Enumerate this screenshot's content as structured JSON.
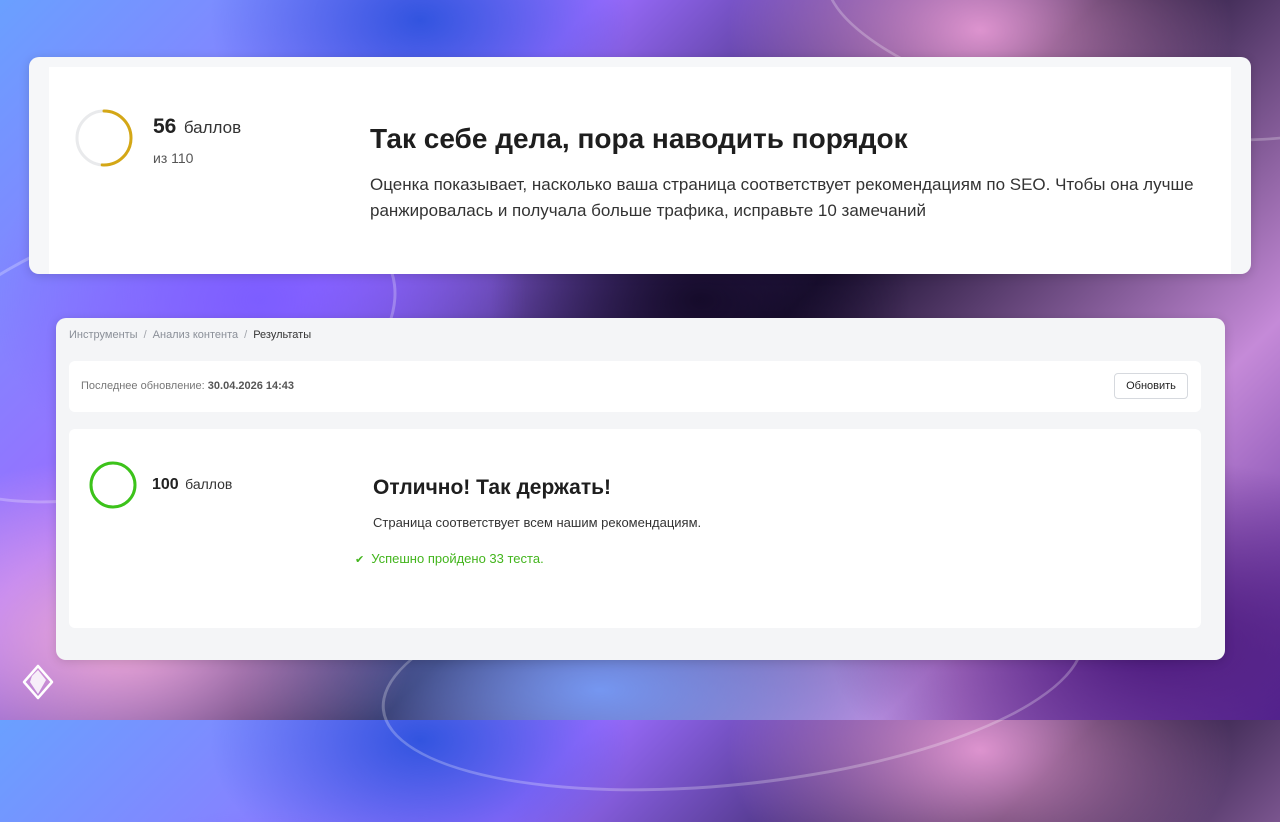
{
  "summary_card": {
    "score_value": "56",
    "score_unit": "баллов",
    "score_total": "из 110",
    "score_progress": 0.51,
    "ring_color": "#d4a716",
    "headline": "Так себе дела, пора наводить порядок",
    "description": "Оценка показывает, насколько ваша страница соответствует рекомендациям по SEO. Чтобы она лучше ранжировалась и получала больше трафика, исправьте 10 замечаний"
  },
  "breadcrumb": {
    "items": [
      "Инструменты",
      "Анализ контента",
      "Результаты"
    ],
    "separator": "/"
  },
  "update_bar": {
    "label": "Последнее обновление:",
    "datetime": "30.04.2026 14:43",
    "refresh_button": "Обновить"
  },
  "result_card": {
    "score_value": "100",
    "score_unit": "баллов",
    "score_progress": 1.0,
    "ring_color": "#3cc31a",
    "headline": "Отлично! Так держать!",
    "description": "Страница соответствует всем нашим рекомендациям.",
    "success_icon": "check-icon",
    "success_text": "Успешно пройдено 33 теста.",
    "success_color": "#43b51d"
  },
  "brand": {
    "logo_icon": "diamond-logo-icon"
  }
}
